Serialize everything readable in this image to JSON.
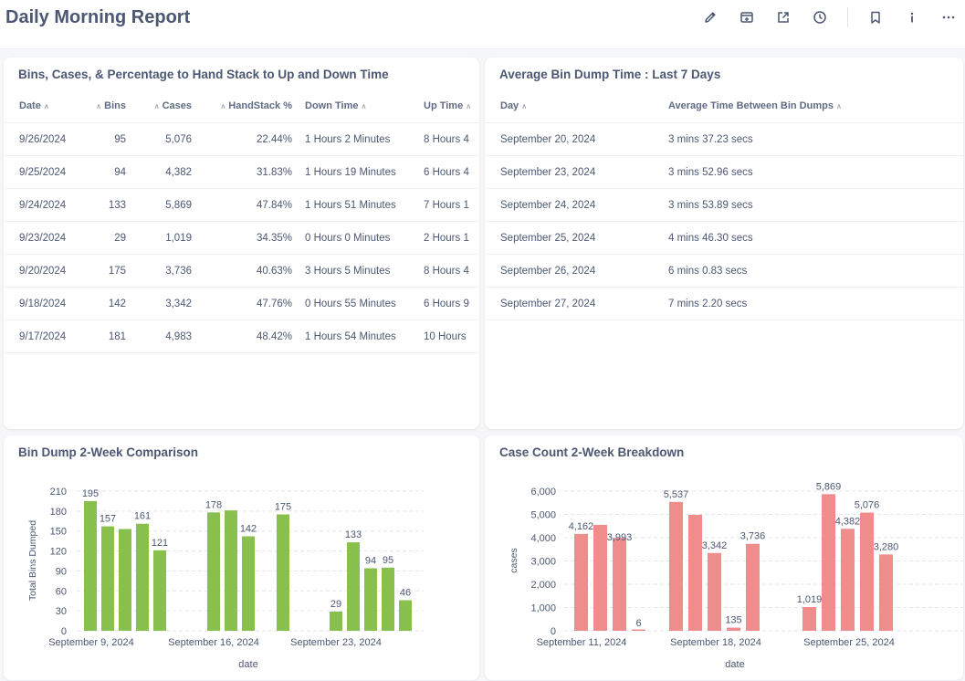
{
  "header": {
    "title": "Daily Morning Report",
    "icons": [
      "pencil-icon",
      "add-to-dashboard-icon",
      "share-icon",
      "clock-icon",
      "bookmark-icon",
      "info-icon",
      "more-icon"
    ]
  },
  "bins_table": {
    "title": "Bins, Cases, & Percentage to Hand Stack to Up and Down Time",
    "columns": [
      "Date",
      "Bins",
      "Cases",
      "HandStack %",
      "Down Time",
      "Up Time"
    ],
    "rows": [
      [
        "9/26/2024",
        "95",
        "5,076",
        "22.44%",
        "1 Hours 2 Minutes",
        "8 Hours 4"
      ],
      [
        "9/25/2024",
        "94",
        "4,382",
        "31.83%",
        "1 Hours 19 Minutes",
        "6 Hours 4"
      ],
      [
        "9/24/2024",
        "133",
        "5,869",
        "47.84%",
        "1 Hours 51 Minutes",
        "7 Hours 1"
      ],
      [
        "9/23/2024",
        "29",
        "1,019",
        "34.35%",
        "0 Hours 0 Minutes",
        "2 Hours 1"
      ],
      [
        "9/20/2024",
        "175",
        "3,736",
        "40.63%",
        "3 Hours 5 Minutes",
        "8 Hours 4"
      ],
      [
        "9/18/2024",
        "142",
        "3,342",
        "47.76%",
        "0 Hours 55 Minutes",
        "6 Hours 9"
      ],
      [
        "9/17/2024",
        "181",
        "4,983",
        "48.42%",
        "1 Hours 54 Minutes",
        "10 Hours"
      ]
    ]
  },
  "dump_table": {
    "title": "Average Bin Dump Time : Last 7 Days",
    "columns": [
      "Day",
      "Average Time Between Bin Dumps"
    ],
    "rows": [
      [
        "September 20, 2024",
        "3 mins 37.23 secs"
      ],
      [
        "September 23, 2024",
        "3 mins 52.96 secs"
      ],
      [
        "September 24, 2024",
        "3 mins 53.89 secs"
      ],
      [
        "September 25, 2024",
        "4 mins 46.30 secs"
      ],
      [
        "September 26, 2024",
        "6 mins 0.83 secs"
      ],
      [
        "September 27, 2024",
        "7 mins 2.20 secs"
      ]
    ]
  },
  "chart_data": [
    {
      "type": "bar",
      "title": "Bin Dump 2-Week Comparison",
      "xlabel": "date",
      "ylabel": "Total Bins Dumped",
      "ylim": [
        0,
        210
      ],
      "yticks": [
        0,
        30,
        60,
        90,
        120,
        150,
        180,
        210
      ],
      "x_tick_labels": [
        "September 9, 2024",
        "September 16, 2024",
        "September 23, 2024"
      ],
      "color": "#88bf4d",
      "categories": [
        "2024-09-09",
        "2024-09-10",
        "2024-09-11",
        "2024-09-12",
        "2024-09-13",
        "2024-09-16",
        "2024-09-17",
        "2024-09-18",
        "2024-09-20",
        "2024-09-23",
        "2024-09-24",
        "2024-09-25",
        "2024-09-26",
        "2024-09-27"
      ],
      "values": [
        195,
        157,
        153,
        161,
        121,
        178,
        181,
        142,
        175,
        29,
        133,
        94,
        95,
        46
      ],
      "data_labels": [
        "195",
        "157",
        "",
        "161",
        "121",
        "178",
        "",
        "142",
        "175",
        "29",
        "133",
        "94",
        "95",
        "46"
      ],
      "grid": true
    },
    {
      "type": "bar",
      "title": "Case Count 2-Week Breakdown",
      "xlabel": "date",
      "ylabel": "cases",
      "ylim": [
        0,
        6000
      ],
      "yticks": [
        0,
        1000,
        2000,
        3000,
        4000,
        5000,
        6000
      ],
      "ytick_labels": [
        "0",
        "1,000",
        "2,000",
        "3,000",
        "4,000",
        "5,000",
        "6,000"
      ],
      "x_tick_labels": [
        "September 11, 2024",
        "September 18, 2024",
        "September 25, 2024"
      ],
      "color": "#ef8c8c",
      "categories": [
        "2024-09-09",
        "2024-09-10",
        "2024-09-11",
        "2024-09-12",
        "2024-09-16",
        "2024-09-17",
        "2024-09-18",
        "2024-09-19",
        "2024-09-20",
        "2024-09-23",
        "2024-09-24",
        "2024-09-25",
        "2024-09-26",
        "2024-09-27"
      ],
      "values": [
        4162,
        4550,
        3993,
        6,
        5537,
        4983,
        3342,
        135,
        3736,
        1019,
        5869,
        4382,
        5076,
        3280
      ],
      "data_labels": [
        "4,162",
        "",
        "3,993",
        "6",
        "5,537",
        "",
        "3,342",
        "135",
        "3,736",
        "1,019",
        "5,869",
        "4,382",
        "5,076",
        "3,280"
      ],
      "grid": true
    }
  ]
}
